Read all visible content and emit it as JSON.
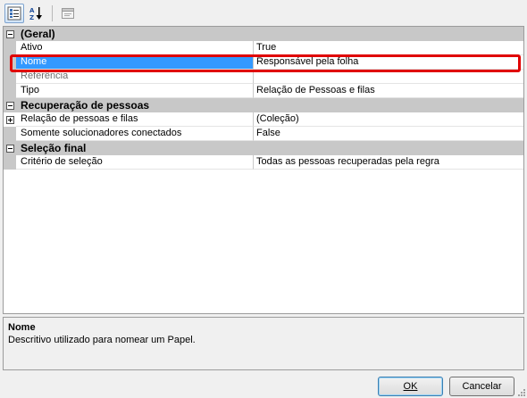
{
  "toolbar": {
    "buttons": [
      {
        "name": "categorized",
        "icon": "categorized-icon",
        "active": true
      },
      {
        "name": "alphabetical",
        "icon": "sort-az-icon",
        "label": "AZ",
        "active": false
      },
      {
        "name": "property-pages",
        "icon": "property-pages-icon",
        "active": false
      }
    ]
  },
  "grid": {
    "categories": [
      {
        "label": "(Geral)",
        "rows": [
          {
            "name": "Ativo",
            "value": "True"
          },
          {
            "name": "Nome",
            "value": "Responsável pela folha"
          },
          {
            "name": "Referência",
            "value": ""
          },
          {
            "name": "Tipo",
            "value": "Relação de Pessoas e filas"
          }
        ]
      },
      {
        "label": "Recuperação de pessoas",
        "rows": [
          {
            "name": "Relação de pessoas e filas",
            "value": "(Coleção)"
          },
          {
            "name": "Somente solucionadores conectados",
            "value": "False"
          }
        ]
      },
      {
        "label": "Seleção final",
        "rows": [
          {
            "name": "Critério de seleção",
            "value": "Todas as pessoas recuperadas pela regra"
          }
        ]
      }
    ],
    "selected_row": "Nome",
    "highlighted_row": "Tipo",
    "highlight_color": "#e00000",
    "selection_color": "#3399ff"
  },
  "help": {
    "title": "Nome",
    "description": "Descritivo utilizado para nomear um Papel."
  },
  "buttons": {
    "ok_label": "OK",
    "cancel_label": "Cancelar"
  }
}
